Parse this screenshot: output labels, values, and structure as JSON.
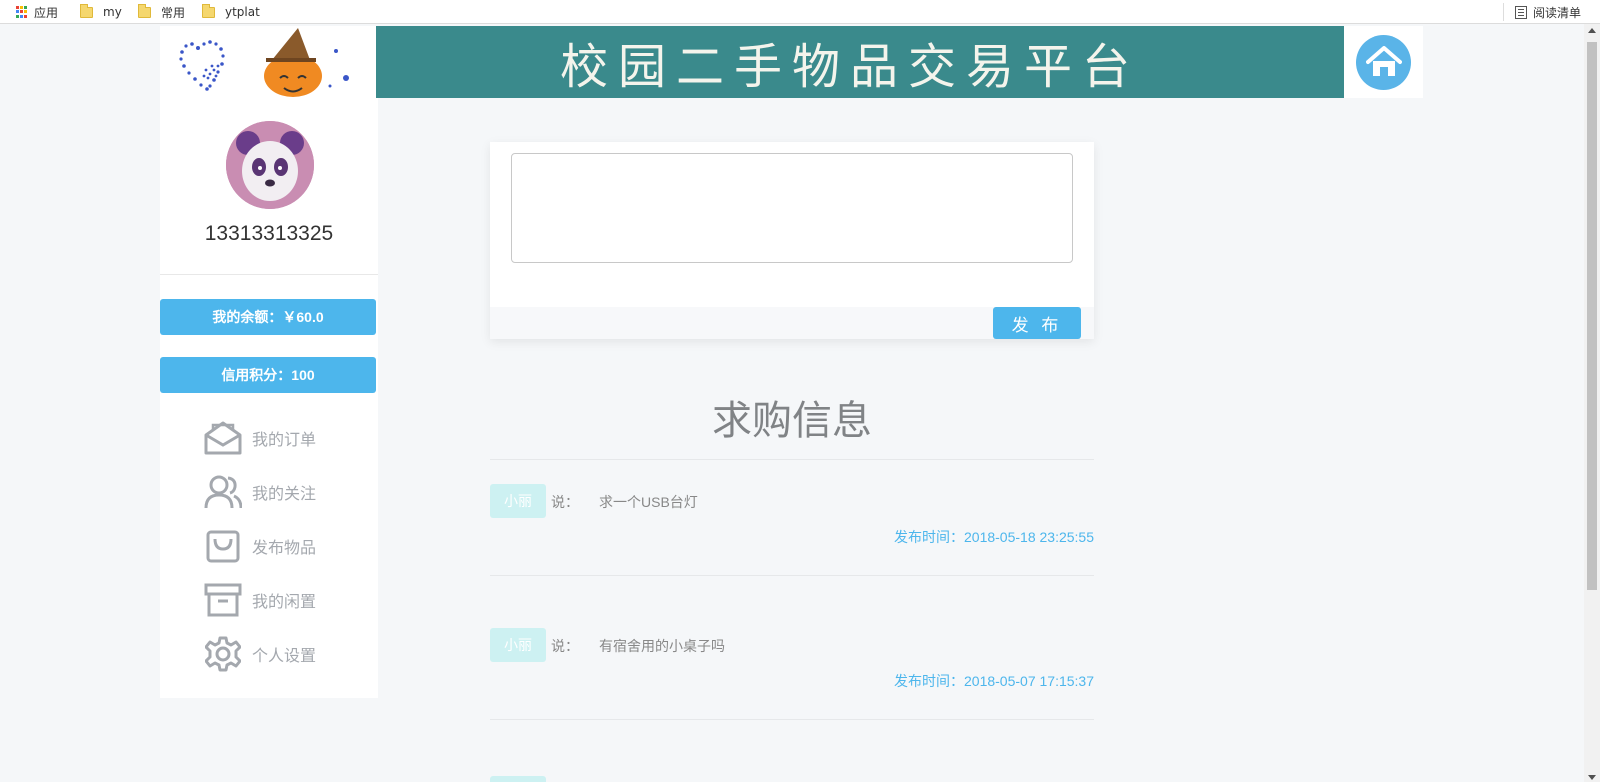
{
  "bookmarks": {
    "apps_label": "应用",
    "items": [
      "my",
      "常用",
      "ytplat"
    ],
    "reading_list_label": "阅读清单"
  },
  "banner": {
    "title": "校园二手物品交易平台"
  },
  "user": {
    "phone": "13313313325",
    "balance_label": "我的余额：￥60.0",
    "credit_label": "信用积分：100"
  },
  "menu": [
    {
      "label": "我的订单",
      "icon": "envelope-open-icon"
    },
    {
      "label": "我的关注",
      "icon": "users-icon"
    },
    {
      "label": "发布物品",
      "icon": "shopping-bag-icon"
    },
    {
      "label": "我的闲置",
      "icon": "archive-box-icon"
    },
    {
      "label": "个人设置",
      "icon": "gear-icon"
    }
  ],
  "publish": {
    "textarea_value": "",
    "button_label": "发 布"
  },
  "section": {
    "title": "求购信息"
  },
  "posts": [
    {
      "name": "小丽",
      "say": "说：",
      "content": "求一个USB台灯",
      "time": "发布时间：2018-05-18 23:25:55"
    },
    {
      "name": "小丽",
      "say": "说：",
      "content": "有宿舍用的小桌子吗",
      "time": "发布时间：2018-05-07 17:15:37"
    }
  ],
  "colors": {
    "accent": "#4db6ec",
    "banner_bg": "#3a8a8c",
    "name_tag_bg": "#cdf1f2",
    "page_bg": "#f5f7f9"
  }
}
